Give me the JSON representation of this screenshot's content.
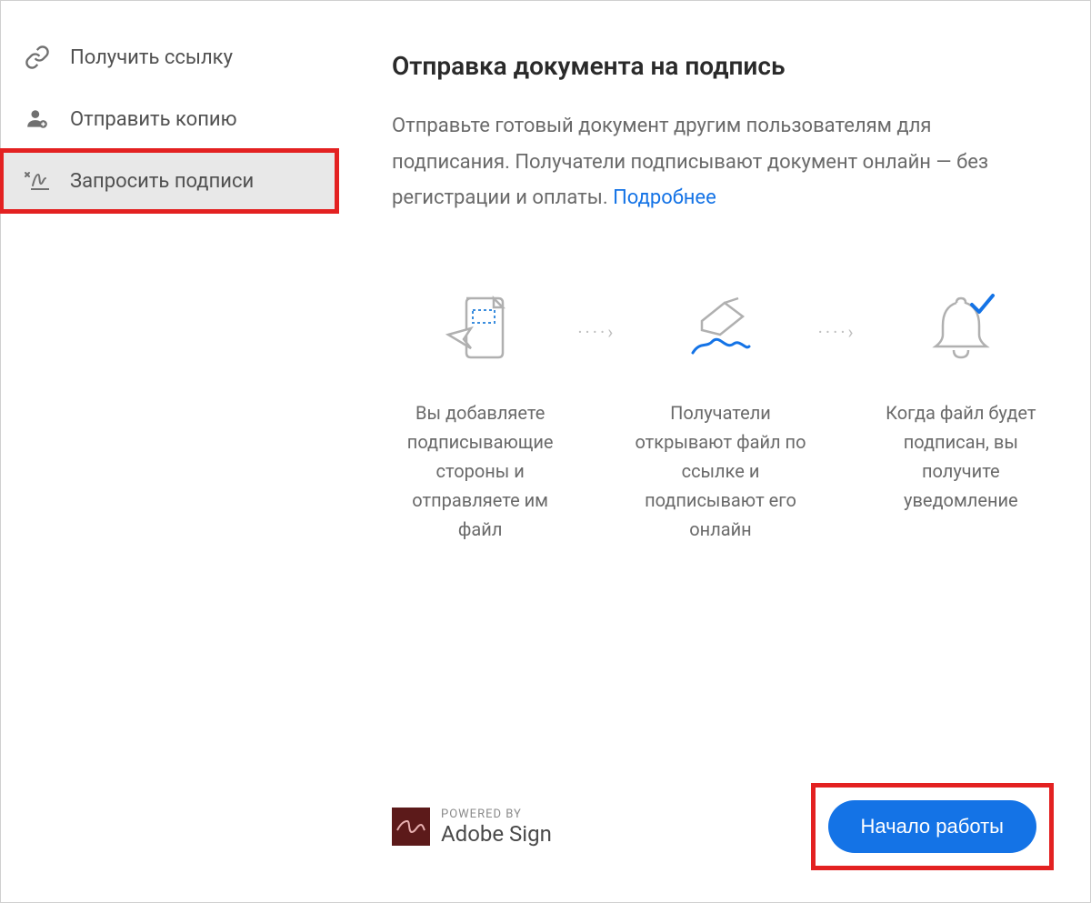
{
  "sidebar": {
    "items": [
      {
        "label": "Получить ссылку"
      },
      {
        "label": "Отправить копию"
      },
      {
        "label": "Запросить подписи"
      }
    ]
  },
  "main": {
    "heading": "Отправка документа на подпись",
    "description_part1": "Отправьте готовый документ другим пользователям для подписания. Получатели подписывают документ онлайн — без регистрации и оплаты. ",
    "link_text": "Подробнее"
  },
  "steps": [
    {
      "text": "Вы добавляете подписывающие стороны и отправляете им файл"
    },
    {
      "text": "Получатели открывают файл по ссылке и подписывают его онлайн"
    },
    {
      "text": "Когда файл будет подписан, вы получите уведомление"
    }
  ],
  "footer": {
    "powered_by": "POWERED BY",
    "brand": "Adobe Sign",
    "cta_label": "Начало работы"
  }
}
